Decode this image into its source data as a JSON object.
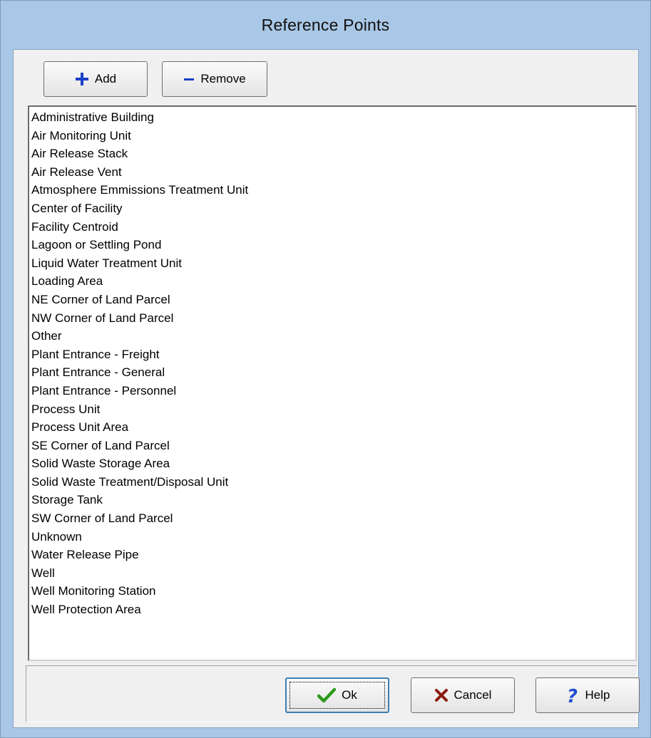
{
  "window": {
    "title": "Reference Points"
  },
  "toolbar": {
    "add_label": "Add",
    "remove_label": "Remove",
    "add_icon": "plus-icon",
    "remove_icon": "minus-icon"
  },
  "reference_points": [
    "Administrative Building",
    "Air Monitoring Unit",
    "Air Release Stack",
    "Air Release Vent",
    "Atmosphere Emmissions Treatment Unit",
    "Center of Facility",
    "Facility Centroid",
    "Lagoon or Settling Pond",
    "Liquid Water Treatment Unit",
    "Loading Area",
    "NE Corner of Land Parcel",
    "NW Corner of Land Parcel",
    "Other",
    "Plant Entrance - Freight",
    "Plant Entrance - General",
    "Plant Entrance - Personnel",
    "Process Unit",
    "Process Unit Area",
    "SE Corner of Land Parcel",
    "Solid Waste Storage Area",
    "Solid Waste Treatment/Disposal Unit",
    "Storage Tank",
    "SW Corner of Land Parcel",
    "Unknown",
    "Water Release Pipe",
    "Well",
    "Well Monitoring Station",
    "Well Protection Area"
  ],
  "footer": {
    "ok_label": "Ok",
    "cancel_label": "Cancel",
    "help_label": "Help",
    "ok_icon": "checkmark-icon",
    "cancel_icon": "x-icon",
    "help_icon": "question-mark-icon"
  },
  "colors": {
    "title_bar": "#a9c7e6",
    "add_icon": "#1a3fc7",
    "remove_icon": "#1a3fc7",
    "ok_icon": "#2e9a1e",
    "cancel_icon": "#8b1a10",
    "help_icon": "#1f4fd1"
  }
}
